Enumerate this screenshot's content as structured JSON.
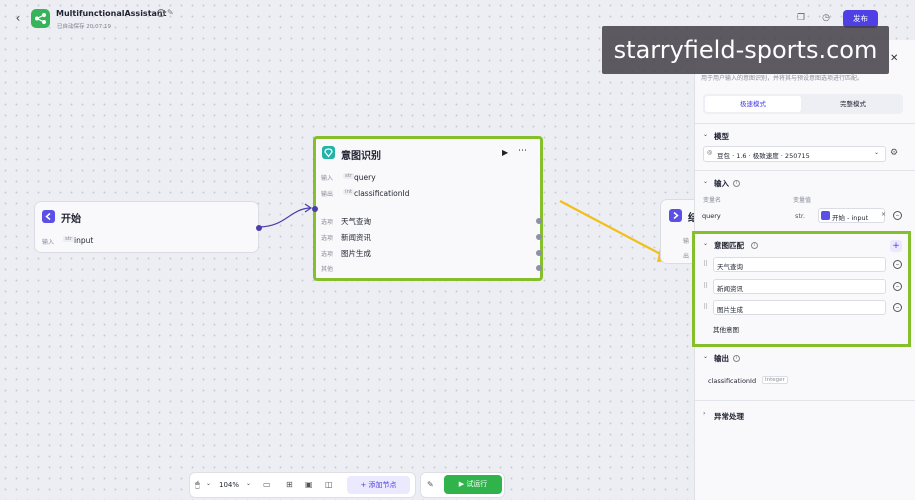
{
  "header": {
    "app_title": "MultifunctionalAssistant",
    "autosave": "已自动保存 20:07:19",
    "publish_label": "发布"
  },
  "watermark": "starryfield-sports.com",
  "start_node": {
    "title": "开始",
    "input_label": "输入",
    "input_type": "str",
    "input_name": "input"
  },
  "intent_node": {
    "title": "意图识别",
    "input_label": "输入",
    "input_type": "str",
    "input_name": "query",
    "output_label": "输出",
    "output_type": "int",
    "output_name": "classificationId",
    "options": [
      {
        "label": "选项",
        "value": "天气查询"
      },
      {
        "label": "选项",
        "value": "新闻资讯"
      },
      {
        "label": "选项",
        "value": "图片生成"
      }
    ],
    "other_label": "其他"
  },
  "next_node": {
    "title_fragment": "结",
    "row1": "输",
    "row2": "出"
  },
  "panel": {
    "description": "用于用户输入的意图识别，并将其与预设意图选项进行匹配。",
    "mode_fast": "极速模式",
    "mode_full": "完整模式",
    "model_title": "模型",
    "model_value": "豆包 · 1.6 · 极致速度 · 250715",
    "input_title": "输入",
    "col_var_name": "变量名",
    "col_var_value": "变量值",
    "input_var_name": "query",
    "input_var_type": "str.",
    "input_var_ref": "开始 - input",
    "intent_title": "意图匹配",
    "intents": [
      "天气查询",
      "新闻资讯",
      "图片生成"
    ],
    "other_intent": "其他意图",
    "output_title": "输出",
    "output_name": "classificationId",
    "output_type": "Integer",
    "error_title": "异常处理"
  },
  "toolbar": {
    "zoom": "104%",
    "add_node_label": "添加节点",
    "run_label": "试运行"
  },
  "colors": {
    "accent": "#4e40e5",
    "highlight_border": "#86bf2c",
    "run_green": "#2fb34a",
    "arrow_yellow": "#f2bf1a"
  }
}
